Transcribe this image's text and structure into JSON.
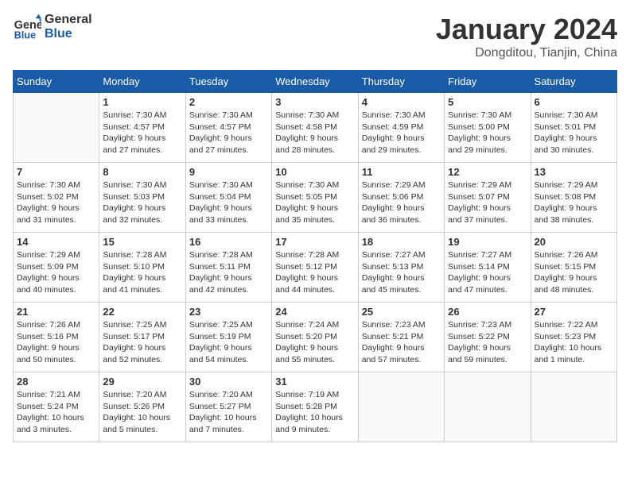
{
  "header": {
    "logo_line1": "General",
    "logo_line2": "Blue",
    "month": "January 2024",
    "location": "Dongditou, Tianjin, China"
  },
  "days_of_week": [
    "Sunday",
    "Monday",
    "Tuesday",
    "Wednesday",
    "Thursday",
    "Friday",
    "Saturday"
  ],
  "weeks": [
    [
      {
        "day": "",
        "content": ""
      },
      {
        "day": "1",
        "content": "Sunrise: 7:30 AM\nSunset: 4:57 PM\nDaylight: 9 hours\nand 27 minutes."
      },
      {
        "day": "2",
        "content": "Sunrise: 7:30 AM\nSunset: 4:57 PM\nDaylight: 9 hours\nand 27 minutes."
      },
      {
        "day": "3",
        "content": "Sunrise: 7:30 AM\nSunset: 4:58 PM\nDaylight: 9 hours\nand 28 minutes."
      },
      {
        "day": "4",
        "content": "Sunrise: 7:30 AM\nSunset: 4:59 PM\nDaylight: 9 hours\nand 29 minutes."
      },
      {
        "day": "5",
        "content": "Sunrise: 7:30 AM\nSunset: 5:00 PM\nDaylight: 9 hours\nand 29 minutes."
      },
      {
        "day": "6",
        "content": "Sunrise: 7:30 AM\nSunset: 5:01 PM\nDaylight: 9 hours\nand 30 minutes."
      }
    ],
    [
      {
        "day": "7",
        "content": "Sunrise: 7:30 AM\nSunset: 5:02 PM\nDaylight: 9 hours\nand 31 minutes."
      },
      {
        "day": "8",
        "content": "Sunrise: 7:30 AM\nSunset: 5:03 PM\nDaylight: 9 hours\nand 32 minutes."
      },
      {
        "day": "9",
        "content": "Sunrise: 7:30 AM\nSunset: 5:04 PM\nDaylight: 9 hours\nand 33 minutes."
      },
      {
        "day": "10",
        "content": "Sunrise: 7:30 AM\nSunset: 5:05 PM\nDaylight: 9 hours\nand 35 minutes."
      },
      {
        "day": "11",
        "content": "Sunrise: 7:29 AM\nSunset: 5:06 PM\nDaylight: 9 hours\nand 36 minutes."
      },
      {
        "day": "12",
        "content": "Sunrise: 7:29 AM\nSunset: 5:07 PM\nDaylight: 9 hours\nand 37 minutes."
      },
      {
        "day": "13",
        "content": "Sunrise: 7:29 AM\nSunset: 5:08 PM\nDaylight: 9 hours\nand 38 minutes."
      }
    ],
    [
      {
        "day": "14",
        "content": "Sunrise: 7:29 AM\nSunset: 5:09 PM\nDaylight: 9 hours\nand 40 minutes."
      },
      {
        "day": "15",
        "content": "Sunrise: 7:28 AM\nSunset: 5:10 PM\nDaylight: 9 hours\nand 41 minutes."
      },
      {
        "day": "16",
        "content": "Sunrise: 7:28 AM\nSunset: 5:11 PM\nDaylight: 9 hours\nand 42 minutes."
      },
      {
        "day": "17",
        "content": "Sunrise: 7:28 AM\nSunset: 5:12 PM\nDaylight: 9 hours\nand 44 minutes."
      },
      {
        "day": "18",
        "content": "Sunrise: 7:27 AM\nSunset: 5:13 PM\nDaylight: 9 hours\nand 45 minutes."
      },
      {
        "day": "19",
        "content": "Sunrise: 7:27 AM\nSunset: 5:14 PM\nDaylight: 9 hours\nand 47 minutes."
      },
      {
        "day": "20",
        "content": "Sunrise: 7:26 AM\nSunset: 5:15 PM\nDaylight: 9 hours\nand 48 minutes."
      }
    ],
    [
      {
        "day": "21",
        "content": "Sunrise: 7:26 AM\nSunset: 5:16 PM\nDaylight: 9 hours\nand 50 minutes."
      },
      {
        "day": "22",
        "content": "Sunrise: 7:25 AM\nSunset: 5:17 PM\nDaylight: 9 hours\nand 52 minutes."
      },
      {
        "day": "23",
        "content": "Sunrise: 7:25 AM\nSunset: 5:19 PM\nDaylight: 9 hours\nand 54 minutes."
      },
      {
        "day": "24",
        "content": "Sunrise: 7:24 AM\nSunset: 5:20 PM\nDaylight: 9 hours\nand 55 minutes."
      },
      {
        "day": "25",
        "content": "Sunrise: 7:23 AM\nSunset: 5:21 PM\nDaylight: 9 hours\nand 57 minutes."
      },
      {
        "day": "26",
        "content": "Sunrise: 7:23 AM\nSunset: 5:22 PM\nDaylight: 9 hours\nand 59 minutes."
      },
      {
        "day": "27",
        "content": "Sunrise: 7:22 AM\nSunset: 5:23 PM\nDaylight: 10 hours\nand 1 minute."
      }
    ],
    [
      {
        "day": "28",
        "content": "Sunrise: 7:21 AM\nSunset: 5:24 PM\nDaylight: 10 hours\nand 3 minutes."
      },
      {
        "day": "29",
        "content": "Sunrise: 7:20 AM\nSunset: 5:26 PM\nDaylight: 10 hours\nand 5 minutes."
      },
      {
        "day": "30",
        "content": "Sunrise: 7:20 AM\nSunset: 5:27 PM\nDaylight: 10 hours\nand 7 minutes."
      },
      {
        "day": "31",
        "content": "Sunrise: 7:19 AM\nSunset: 5:28 PM\nDaylight: 10 hours\nand 9 minutes."
      },
      {
        "day": "",
        "content": ""
      },
      {
        "day": "",
        "content": ""
      },
      {
        "day": "",
        "content": ""
      }
    ]
  ]
}
